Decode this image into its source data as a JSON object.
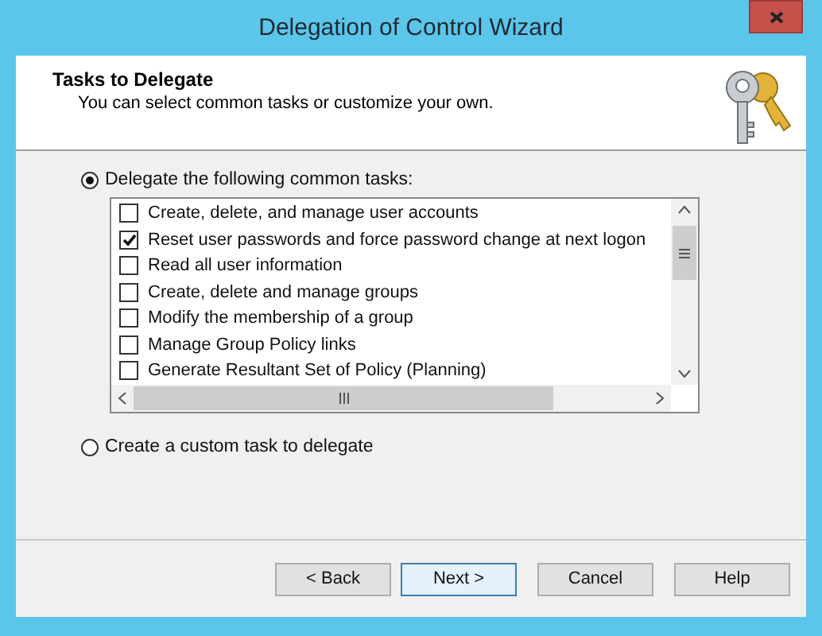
{
  "window": {
    "title": "Delegation of Control Wizard"
  },
  "header": {
    "title": "Tasks to Delegate",
    "subtitle": "You can select common tasks or customize your own."
  },
  "options": [
    {
      "label": "Delegate the following common tasks:",
      "selected": true,
      "tasks": [
        {
          "label": "Create, delete, and manage user accounts",
          "checked": false
        },
        {
          "label": "Reset user passwords and force password change at next logon",
          "checked": true
        },
        {
          "label": "Read all user information",
          "checked": false
        },
        {
          "label": "Create, delete and manage groups",
          "checked": false
        },
        {
          "label": "Modify the membership of a group",
          "checked": false
        },
        {
          "label": "Manage Group Policy links",
          "checked": false
        },
        {
          "label": "Generate Resultant Set of Policy (Planning)",
          "checked": false
        }
      ]
    },
    {
      "label": "Create a custom task to delegate",
      "selected": false
    }
  ],
  "buttons": [
    {
      "label": "< Back",
      "default": false
    },
    {
      "label": "Next >",
      "default": true
    },
    {
      "label": "Cancel",
      "default": false
    },
    {
      "label": "Help",
      "default": false
    }
  ]
}
